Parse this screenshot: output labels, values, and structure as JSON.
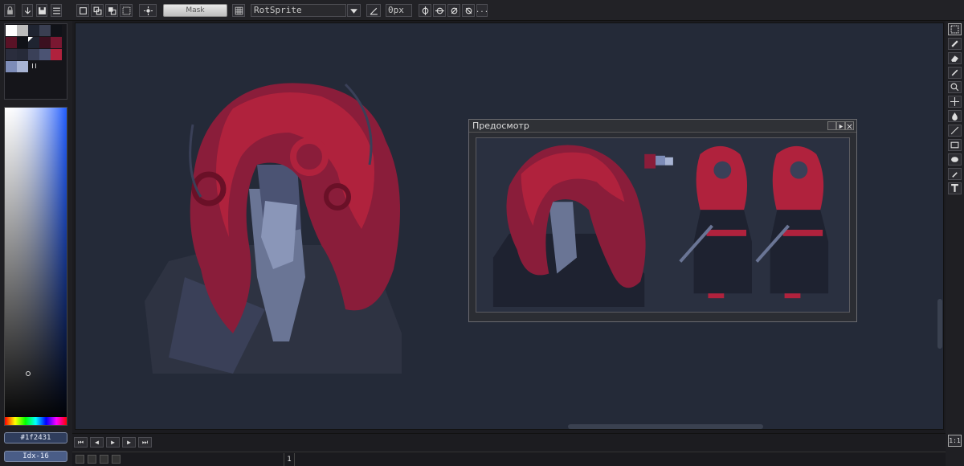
{
  "toolbar": {
    "mask_label": "Mask",
    "resize_method": "RotSprite",
    "offset_value": "0px",
    "more_label": "..."
  },
  "colors": {
    "current_hex": "#1f2431",
    "index_label": "Idx-16"
  },
  "palette": [
    "#ffffff",
    "#bcbcbc",
    "#1f2431",
    "#3a3f52",
    "#101218",
    "#5a1226",
    "#7a1731",
    "#8a1d3a",
    "#2a2d3d",
    "#262a39",
    "#3a4058",
    "#4b5373",
    "#6a7aa0",
    "#b0223d",
    "#7d8cb8",
    "#a8b4d4"
  ],
  "preview": {
    "title": "Предосмотр"
  },
  "animation": {
    "frame_number": "1",
    "zoom_label": "1:1"
  },
  "tools": [
    "select-tool",
    "pencil-tool",
    "eraser-tool",
    "brush-tool",
    "zoom-tool",
    "move-tool",
    "fill-tool",
    "line-tool",
    "rectangle-tool",
    "shading-tool",
    "smudge-tool",
    "text-tool"
  ]
}
